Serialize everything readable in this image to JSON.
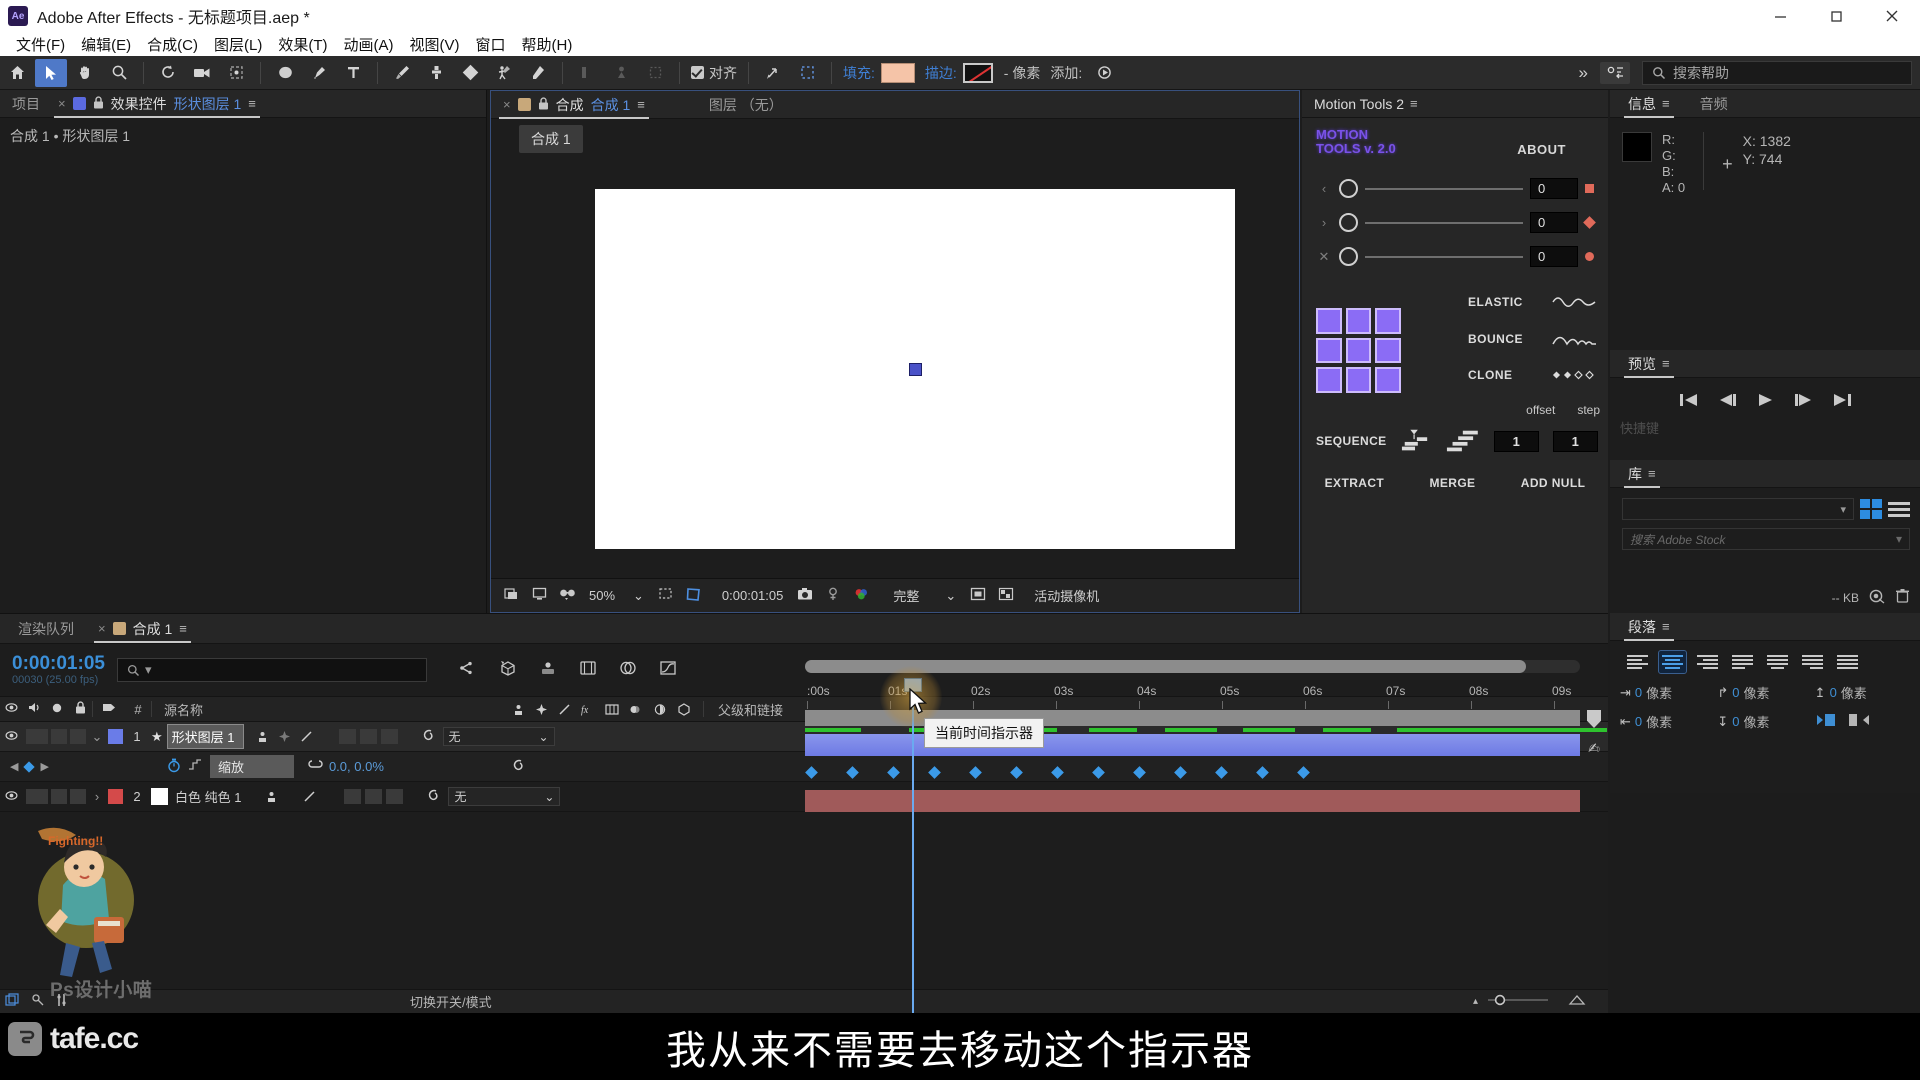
{
  "window": {
    "title": "Adobe After Effects - 无标题项目.aep *",
    "logo": "Ae",
    "controls": {
      "minimize": "minimize-icon",
      "maximize": "maximize-icon",
      "close": "close-icon"
    }
  },
  "menu": {
    "items": [
      {
        "label": "文件(F)"
      },
      {
        "label": "编辑(E)"
      },
      {
        "label": "合成(C)"
      },
      {
        "label": "图层(L)"
      },
      {
        "label": "效果(T)"
      },
      {
        "label": "动画(A)"
      },
      {
        "label": "视图(V)"
      },
      {
        "label": "窗口"
      },
      {
        "label": "帮助(H)"
      }
    ]
  },
  "toolbar": {
    "tools": [
      {
        "name": "home-icon"
      },
      {
        "name": "selection-tool-icon"
      },
      {
        "name": "hand-tool-icon"
      },
      {
        "name": "zoom-tool-icon"
      },
      {
        "name": "rotation-tool-icon"
      },
      {
        "name": "camera-tool-icon"
      },
      {
        "name": "pan-behind-tool-icon"
      },
      {
        "name": "shape-tool-icon"
      },
      {
        "name": "pen-tool-icon"
      },
      {
        "name": "type-tool-icon"
      },
      {
        "name": "brush-tool-icon"
      },
      {
        "name": "clone-stamp-tool-icon"
      },
      {
        "name": "eraser-tool-icon"
      },
      {
        "name": "roto-brush-tool-icon"
      },
      {
        "name": "puppet-tool-icon"
      }
    ],
    "align_label": "对齐",
    "fill_label": "填充:",
    "fill_color": "#f5c4a8",
    "stroke_label": "描边:",
    "stroke_value": "- 像素",
    "add_label": "添加:",
    "overflow": "»",
    "workspace_icon": "workspace-icon",
    "help_placeholder": "搜索帮助"
  },
  "project_panel": {
    "tabs": [
      {
        "label": "项目",
        "active": false,
        "closable": false
      },
      {
        "label": "效果控件",
        "highlight": "形状图层 1",
        "active": true,
        "closable": true
      }
    ],
    "breadcrumb": "合成 1 • 形状图层 1"
  },
  "comp_panel": {
    "tabs": [
      {
        "label": "合成",
        "highlight": "合成 1",
        "active": true
      }
    ],
    "layer_tab": "图层 （无）",
    "sub_tab": "合成 1",
    "bottom": {
      "zoom": "50%",
      "timecode": "0:00:01:05",
      "quality": "完整",
      "camera": "活动摄像机",
      "icons": [
        "render-icon",
        "monitor-icon",
        "3d-glasses-icon",
        "grid-icon",
        "region-of-interest-icon",
        "snapshot-icon",
        "show-snapshot-icon",
        "channels-icon",
        "transparency-grid-icon",
        "toggle-mask-icon"
      ]
    }
  },
  "motion_tools": {
    "panel_title": "Motion Tools 2",
    "logo_line1": "MOTION",
    "logo_line2": "TOOLS v. 2.0",
    "about": "ABOUT",
    "sliders": [
      {
        "icon": "ease-in-icon",
        "value": "0",
        "dot": "square"
      },
      {
        "icon": "ease-out-icon",
        "value": "0",
        "dot": "diamond"
      },
      {
        "icon": "ease-both-icon",
        "value": "0",
        "dot": "circle"
      }
    ],
    "anchor_grid_label": "anchor-point-grid",
    "effects": [
      {
        "label": "ELASTIC",
        "icon": "elastic-wave-icon"
      },
      {
        "label": "BOUNCE",
        "icon": "bounce-wave-icon"
      },
      {
        "label": "CLONE",
        "icon": "clone-dots-icon"
      }
    ],
    "offset_label": "offset",
    "step_label": "step",
    "sequence_label": "SEQUENCE",
    "offset_value": "1",
    "step_value": "1",
    "actions": [
      {
        "label": "EXTRACT"
      },
      {
        "label": "MERGE"
      },
      {
        "label": "ADD NULL"
      }
    ]
  },
  "info_panel": {
    "tabs": [
      {
        "label": "信息",
        "active": true
      },
      {
        "label": "音频",
        "active": false
      }
    ],
    "channels": [
      {
        "label": "R:",
        "value": ""
      },
      {
        "label": "G:",
        "value": ""
      },
      {
        "label": "B:",
        "value": ""
      },
      {
        "label": "A:",
        "value": "0"
      }
    ],
    "x": "X: 1382",
    "y": "Y: 744"
  },
  "preview_panel": {
    "title": "预览",
    "controls": [
      "first-frame-icon",
      "prev-frame-icon",
      "play-icon",
      "next-frame-icon",
      "last-frame-icon"
    ],
    "footer": "快捷键"
  },
  "library_panel": {
    "title": "库",
    "dropdown_value": "",
    "search_placeholder": "搜索 Adobe Stock",
    "size": "-- KB",
    "icons": [
      "grid-view-icon",
      "list-view-icon",
      "sync-off-icon",
      "trash-icon"
    ]
  },
  "paragraph_panel": {
    "title": "段落",
    "align_buttons": [
      {
        "name": "align-left",
        "active": false
      },
      {
        "name": "align-center",
        "active": true
      },
      {
        "name": "align-right",
        "active": false
      },
      {
        "name": "justify-last-left",
        "active": false
      },
      {
        "name": "justify-last-center",
        "active": false
      },
      {
        "name": "justify-last-right",
        "active": false
      },
      {
        "name": "justify-all",
        "active": false
      }
    ],
    "fields": [
      {
        "icon": "indent-left-icon",
        "value": "0",
        "unit": "像素"
      },
      {
        "icon": "indent-first-line-icon",
        "value": "0",
        "unit": "像素"
      },
      {
        "icon": "space-before-icon",
        "value": "0",
        "unit": "像素"
      },
      {
        "icon": "indent-right-icon",
        "value": "0",
        "unit": "像素"
      },
      {
        "icon": "space-after-icon",
        "value": "0",
        "unit": "像素"
      }
    ],
    "direction_buttons": [
      "ltr-icon",
      "rtl-icon"
    ]
  },
  "timeline": {
    "tabs": [
      {
        "label": "渲染队列",
        "active": false
      },
      {
        "label": "合成 1",
        "active": true
      }
    ],
    "current_time": "0:00:01:05",
    "frame_info": "00030 (25.00 fps)",
    "search_placeholder": "",
    "toolbar_icons": [
      "link-icon",
      "3d-renderer-icon",
      "motion-blur-icon",
      "frame-blend-icon",
      "shy-icon",
      "graph-editor-icon"
    ],
    "columns": [
      {
        "label": "",
        "name": "eye-column"
      },
      {
        "label": "#",
        "name": "index-column"
      },
      {
        "label": "源名称",
        "name": "source-name-column"
      },
      {
        "label": "",
        "name": "switches-column"
      },
      {
        "label": "父级和链接",
        "name": "parent-link-column"
      }
    ],
    "layers": [
      {
        "index": "1",
        "name": "形状图层 1",
        "color": "#6a7ce8",
        "type_icon": "star-icon",
        "parent": "无",
        "selected": true,
        "bar_color": "#7a88e8",
        "property": {
          "name": "缩放",
          "value": "0.0, 0.0%",
          "stopwatch": "stopwatch-icon",
          "graph": "graph-icon"
        }
      },
      {
        "index": "2",
        "name": "白色 纯色 1",
        "color": "#d44a4a",
        "swatch": "#ffffff",
        "parent": "无",
        "selected": false,
        "bar_color": "#a05a5a"
      }
    ],
    "ruler_ticks": [
      ":00s",
      "01s",
      "02s",
      "03s",
      "04s",
      "05s",
      "06s",
      "07s",
      "08s",
      "09s"
    ],
    "keyframe_count": 13,
    "tooltip": "当前时间指示器",
    "bottom_bar": {
      "icons": [
        "frame-blend-toggle-icon",
        "motion-blur-toggle-icon",
        "graph-toggle-icon"
      ],
      "mode_label": "切换开关/模式"
    }
  },
  "watermark": {
    "brand": "Ps设计小喵",
    "logo": "tafe.cc"
  },
  "subtitle": {
    "text": "我从来不需要去移动这个指示器"
  }
}
